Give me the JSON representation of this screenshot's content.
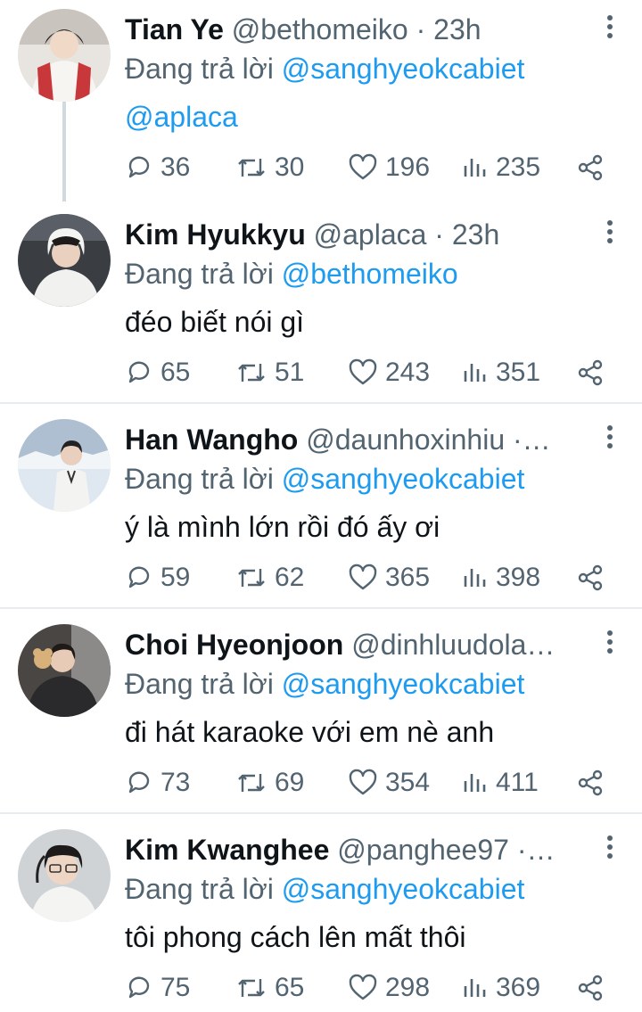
{
  "icons": {
    "reply": "speech-bubble-icon",
    "retweet": "retweet-icon",
    "like": "heart-icon",
    "views": "bar-chart-icon",
    "share": "share-icon",
    "more": "vertical-ellipsis-icon"
  },
  "colors": {
    "link": "#1d9bf0",
    "muted": "#536471",
    "text": "#0f1419",
    "divider": "#e6ecf0"
  },
  "replying_label": "Đang trả lời",
  "tweets": [
    {
      "name": "Tian Ye",
      "handle": "@bethomeiko",
      "time": "23h",
      "sep": " · ",
      "reply_to": "@sanghyeokcabiet",
      "reply_to_2": "@aplaca",
      "text": "",
      "replies": "36",
      "retweets": "30",
      "likes": "196",
      "views": "235"
    },
    {
      "name": "Kim Hyukkyu",
      "handle": "@aplaca",
      "time": "23h",
      "sep": " · ",
      "reply_to": "@bethomeiko",
      "text": "đéo biết nói gì",
      "replies": "65",
      "retweets": "51",
      "likes": "243",
      "views": "351"
    },
    {
      "name": "Han Wangho",
      "handle": "@daunhoxinhiu",
      "time": "",
      "sep": " ·…",
      "reply_to": "@sanghyeokcabiet",
      "text": "ý là mình lớn rồi đó ấy ơi",
      "replies": "59",
      "retweets": "62",
      "likes": "365",
      "views": "398"
    },
    {
      "name": "Choi Hyeonjoon",
      "handle": "@dinhluudola…",
      "time": "",
      "sep": "",
      "reply_to": "@sanghyeokcabiet",
      "text": "đi hát karaoke với em nè anh",
      "replies": "73",
      "retweets": "69",
      "likes": "354",
      "views": "411"
    },
    {
      "name": "Kim Kwanghee",
      "handle": "@panghee97",
      "time": "",
      "sep": " ·…",
      "reply_to": "@sanghyeokcabiet",
      "text": "tôi phong cách lên mất thôi",
      "replies": "75",
      "retweets": "65",
      "likes": "298",
      "views": "369"
    }
  ]
}
